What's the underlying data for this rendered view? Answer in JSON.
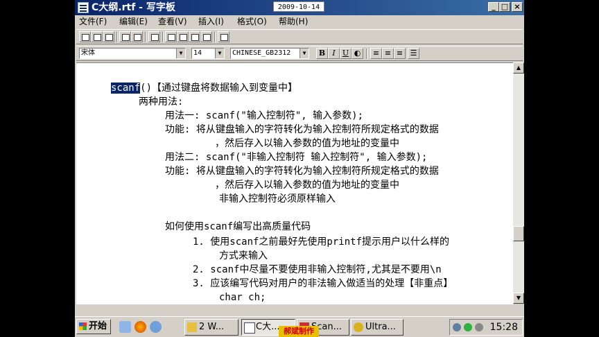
{
  "window": {
    "title": "C大纲.rtf - 写字板",
    "date_badge": "2009-10-14",
    "controls": {
      "minimize": "_",
      "maximize": "□",
      "close": "×"
    }
  },
  "menu": [
    "文件(F)",
    "编辑(E)",
    "查看(V)",
    "插入(I)",
    "格式(O)",
    "帮助(H)"
  ],
  "toolbar_icons": [
    "new-icon",
    "open-icon",
    "save-icon",
    "print-icon",
    "print-preview-icon",
    "find-icon",
    "cut-icon",
    "copy-icon",
    "paste-icon",
    "undo-icon",
    "datetime-icon"
  ],
  "format": {
    "font": "宋体",
    "size": "14",
    "script": "CHINESE_GB2312",
    "bold": "B",
    "italic": "I",
    "underline": "U"
  },
  "document": {
    "lines": [
      {
        "highlight": "scanf",
        "text": "()【通过键盘将数据输入到变量中】"
      },
      {
        "text": "两种用法:"
      },
      {
        "text": "用法一:  scanf(\"输入控制符\", 输入参数);"
      },
      {
        "text": "功能:    将从键盘输入的字符转化为输入控制符所规定格式的数据"
      },
      {
        "text": "，然后存入以输入参数的值为地址的变量中"
      },
      {
        "text": "用法二:  scanf(\"非输入控制符 输入控制符\", 输入参数);"
      },
      {
        "text": "功能:    将从键盘输入的字符转化为输入控制符所规定格式的数据"
      },
      {
        "text": "，然后存入以输入参数的值为地址的变量中"
      },
      {
        "text": "非输入控制符必须原样输入"
      },
      {
        "text": "如何使用scanf编写出高质量代码"
      },
      {
        "text": "1. 使用scanf之前最好先使用printf提示用户以什么样的"
      },
      {
        "text": "方式来输入"
      },
      {
        "text": "2. scanf中尽量不要使用非输入控制符,尤其是不要用\\n"
      },
      {
        "text": "3. 应该编写代码对用户的非法输入做适当的处理【非重点】"
      },
      {
        "text": "char ch;"
      }
    ]
  },
  "taskbar": {
    "start": "开始",
    "tasks": [
      "2 W...",
      "C大...",
      "Scan...",
      "Ultra..."
    ],
    "clock": "15:28"
  },
  "watermark": "郝斌制作",
  "colors": {
    "title_bar": "#0a246a",
    "selection": "#0a246a",
    "chrome": "#d4d0c8"
  }
}
